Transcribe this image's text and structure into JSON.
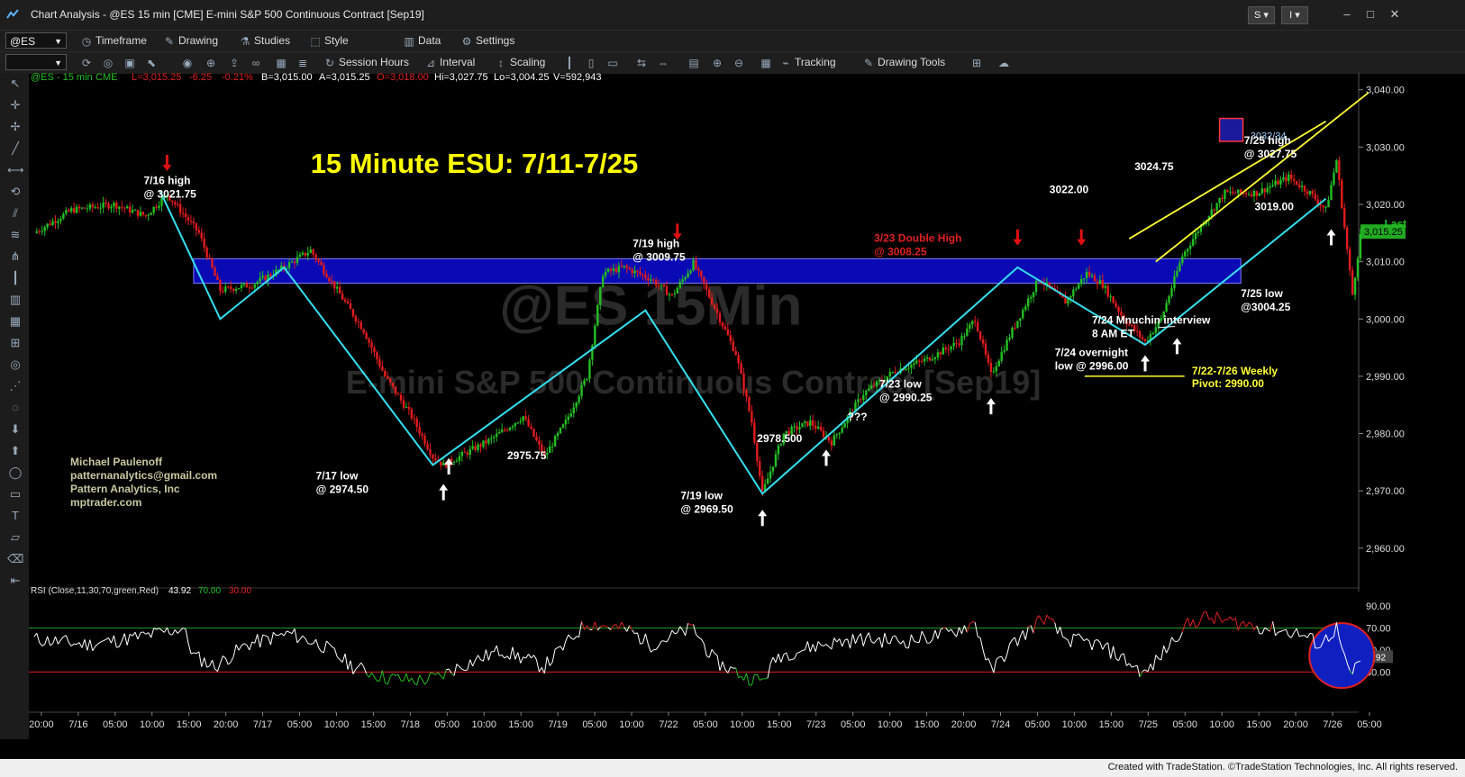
{
  "window": {
    "title": "Chart Analysis - @ES 15 min [CME] E-mini S&P 500 Continuous Contract [Sep19]",
    "btn_s": "S ▾",
    "btn_i": "I ▾"
  },
  "toolbar1": {
    "symbol": "@ES",
    "items": [
      "Timeframe",
      "Drawing",
      "Studies",
      "Style",
      "Data",
      "Settings"
    ]
  },
  "toolbar2": {
    "items": [
      "Session Hours",
      "Interval",
      "Scaling",
      "Tracking",
      "Drawing Tools"
    ]
  },
  "info": {
    "symbol": "@ES - 15 min",
    "exchange": "CME",
    "last": "L=3,015.25",
    "chg": "-6.25",
    "pct": "-0.21%",
    "bid": "B=3,015.00",
    "ask": "A=3,015.25",
    "open": "O=3,018.00",
    "high": "Hi=3,027.75",
    "low": "Lo=3,004.25",
    "vol": "V=592,943"
  },
  "watermark": {
    "line1": "@ES 15Min",
    "line2": "E-mini S&P 500 Continuous Contract [Sep19]"
  },
  "author": {
    "name": "Michael Paulenoff",
    "email": "patternanalytics@gmail.com",
    "company": "Pattern Analytics, Inc",
    "site": "mptrader.com"
  },
  "rsi": {
    "label": "RSI (Close,11,30,70,green,Red)",
    "value": "43.92",
    "ob": "70.00",
    "os": "30.00",
    "ticks": [
      {
        "v": 90,
        "label": "90.00"
      },
      {
        "v": 70,
        "label": "70.00"
      },
      {
        "v": 50,
        "label": "50.00"
      },
      {
        "v": 30,
        "label": "30.00"
      }
    ]
  },
  "status": {
    "text": "Created with TradeStation. ©TradeStation Technologies, Inc. All rights reserved."
  },
  "colors": {
    "up": "#22c022",
    "down": "#e21b1b",
    "zone": "#0a0ab4",
    "channel": "#ffff33",
    "trend": "#33e0f0",
    "title": "#ffff00",
    "last_badge": "#22aa22"
  },
  "chart_data": {
    "type": "candlestick",
    "title": "15 Minute ESU: 7/11-7/25",
    "ylim": [
      2954,
      3042
    ],
    "y_ticks": [
      {
        "v": 3040,
        "label": "3,040.00"
      },
      {
        "v": 3030,
        "label": "3,030.00"
      },
      {
        "v": 3020,
        "label": "3,020.00"
      },
      {
        "v": 3010,
        "label": "3,010.00"
      },
      {
        "v": 3000,
        "label": "3,000.00"
      },
      {
        "v": 2990,
        "label": "2,990.00"
      },
      {
        "v": 2980,
        "label": "2,980.00"
      },
      {
        "v": 2970,
        "label": "2,970.00"
      },
      {
        "v": 2960,
        "label": "2,960.00"
      }
    ],
    "x_ticks": [
      "20:00",
      "7/16",
      "05:00",
      "10:00",
      "15:00",
      "20:00",
      "7/17",
      "05:00",
      "10:00",
      "15:00",
      "7/18",
      "05:00",
      "10:00",
      "15:00",
      "7/19",
      "05:00",
      "10:00",
      "7/22",
      "05:00",
      "10:00",
      "15:00",
      "7/23",
      "05:00",
      "10:00",
      "15:00",
      "20:00",
      "7/24",
      "05:00",
      "10:00",
      "15:00",
      "7/25",
      "05:00",
      "10:00",
      "15:00",
      "20:00",
      "7/26",
      "05:00"
    ],
    "last_price": {
      "v": 3015.25,
      "label": "3,015.25",
      "tag": "Last"
    },
    "resistance_zone": [
      3006.25,
      3010.5
    ],
    "target_box": {
      "label": "3032/34",
      "range": [
        3032,
        3034
      ]
    },
    "weekly_pivot": {
      "v": 2990,
      "label1": "7/22-7/26 Weekly",
      "label2": "Pivot: 2990.00"
    },
    "path": [
      [
        0.0,
        3015
      ],
      [
        3.5,
        3019
      ],
      [
        7.5,
        3020
      ],
      [
        10.5,
        3018
      ],
      [
        12.5,
        3021.75
      ],
      [
        15.5,
        3015
      ],
      [
        17.5,
        3005
      ],
      [
        20.5,
        3006
      ],
      [
        23.5,
        3009
      ],
      [
        26.0,
        3012
      ],
      [
        28.5,
        3005
      ],
      [
        31.0,
        2998
      ],
      [
        33.0,
        2990
      ],
      [
        35.5,
        2983
      ],
      [
        37.5,
        2976
      ],
      [
        38.5,
        2974.5
      ],
      [
        41.0,
        2977
      ],
      [
        43.0,
        2979
      ],
      [
        46.0,
        2983
      ],
      [
        48.0,
        2976
      ],
      [
        50.0,
        2982
      ],
      [
        52.0,
        2990
      ],
      [
        53.5,
        3008
      ],
      [
        55.5,
        3009
      ],
      [
        58.0,
        3007
      ],
      [
        60.0,
        3004
      ],
      [
        62.0,
        3009.75
      ],
      [
        64.0,
        3002
      ],
      [
        66.0,
        2994
      ],
      [
        67.5,
        2982
      ],
      [
        68.5,
        2969.5
      ],
      [
        70.5,
        2980
      ],
      [
        73.0,
        2982
      ],
      [
        75.0,
        2978.5
      ],
      [
        78.0,
        2987
      ],
      [
        81.0,
        2991
      ],
      [
        84.0,
        2993
      ],
      [
        87.0,
        2996
      ],
      [
        88.5,
        3000
      ],
      [
        90.0,
        2990.25
      ],
      [
        92.0,
        2998
      ],
      [
        94.5,
        3007
      ],
      [
        97.0,
        3003
      ],
      [
        99.0,
        3008
      ],
      [
        100.5,
        3006
      ],
      [
        102.5,
        3000
      ],
      [
        104.5,
        2996
      ],
      [
        106.0,
        3000
      ],
      [
        108.0,
        3011
      ],
      [
        110.0,
        3017
      ],
      [
        112.0,
        3022
      ],
      [
        115.0,
        3022
      ],
      [
        118.0,
        3024.75
      ],
      [
        120.0,
        3022
      ],
      [
        121.5,
        3019
      ],
      [
        122.5,
        3027.75
      ],
      [
        124.0,
        3004.25
      ],
      [
        124.8,
        3015.25
      ]
    ],
    "rsi_path": [
      [
        0,
        60
      ],
      [
        5,
        55
      ],
      [
        10,
        62
      ],
      [
        14,
        70
      ],
      [
        15,
        45
      ],
      [
        17,
        35
      ],
      [
        20,
        55
      ],
      [
        24,
        65
      ],
      [
        27,
        55
      ],
      [
        30,
        35
      ],
      [
        33,
        25
      ],
      [
        36,
        22
      ],
      [
        38,
        25
      ],
      [
        40,
        35
      ],
      [
        44,
        50
      ],
      [
        48,
        35
      ],
      [
        50,
        55
      ],
      [
        52,
        75
      ],
      [
        56,
        68
      ],
      [
        58,
        55
      ],
      [
        62,
        70
      ],
      [
        64,
        40
      ],
      [
        67,
        25
      ],
      [
        68.5,
        22
      ],
      [
        70,
        45
      ],
      [
        74,
        55
      ],
      [
        78,
        60
      ],
      [
        82,
        58
      ],
      [
        86,
        65
      ],
      [
        88.5,
        75
      ],
      [
        90,
        30
      ],
      [
        92,
        55
      ],
      [
        95,
        80
      ],
      [
        97,
        60
      ],
      [
        100,
        55
      ],
      [
        102,
        45
      ],
      [
        104.5,
        28
      ],
      [
        106,
        45
      ],
      [
        108,
        70
      ],
      [
        110,
        80
      ],
      [
        113,
        75
      ],
      [
        116,
        70
      ],
      [
        119,
        65
      ],
      [
        121,
        55
      ],
      [
        122.5,
        70
      ],
      [
        123.5,
        32
      ],
      [
        124,
        28
      ],
      [
        124.8,
        43.92
      ]
    ],
    "annotations": [
      {
        "x": 10.3,
        "y": 3023.5,
        "lines": [
          "7/16 high",
          "@ 3021.75"
        ]
      },
      {
        "x": 26.5,
        "y": 2972,
        "lines": [
          "7/17 low",
          "@ 2974.50"
        ]
      },
      {
        "x": 44.5,
        "y": 2975.5,
        "lines": [
          "2975.75"
        ]
      },
      {
        "x": 56.3,
        "y": 3012.5,
        "lines": [
          "7/19 high",
          "@ 3009.75"
        ]
      },
      {
        "x": 60.8,
        "y": 2968.5,
        "lines": [
          "7/19 low",
          "@ 2969.50"
        ]
      },
      {
        "x": 68.0,
        "y": 2978.5,
        "lines": [
          "2978.500"
        ]
      },
      {
        "x": 79.5,
        "y": 2988,
        "lines": [
          "7/23 low",
          "@ 2990.25"
        ]
      },
      {
        "x": 79.0,
        "y": 3013.5,
        "lines": [
          "3/23 Double High",
          "@ 3008.25"
        ]
      },
      {
        "x": 96.0,
        "y": 2993.5,
        "lines": [
          "7/24 overnight",
          "low @ 2996.00"
        ]
      },
      {
        "x": 99.5,
        "y": 2999.2,
        "lines": [
          "7/24 Mnuchin interview",
          "8 AM ET"
        ]
      },
      {
        "x": 95.5,
        "y": 3022,
        "lines": [
          "3022.00"
        ]
      },
      {
        "x": 103.5,
        "y": 3026,
        "lines": [
          "3024.75"
        ]
      },
      {
        "x": 113.8,
        "y": 3030.5,
        "lines": [
          "7/25 high",
          "@ 3027.75"
        ]
      },
      {
        "x": 114.8,
        "y": 3019,
        "lines": [
          "3019.00"
        ]
      },
      {
        "x": 113.5,
        "y": 3003.8,
        "lines": [
          "7/25 low",
          "@3004.25"
        ]
      },
      {
        "x": 76.5,
        "y": 2982.3,
        "lines": [
          "???"
        ]
      }
    ]
  }
}
